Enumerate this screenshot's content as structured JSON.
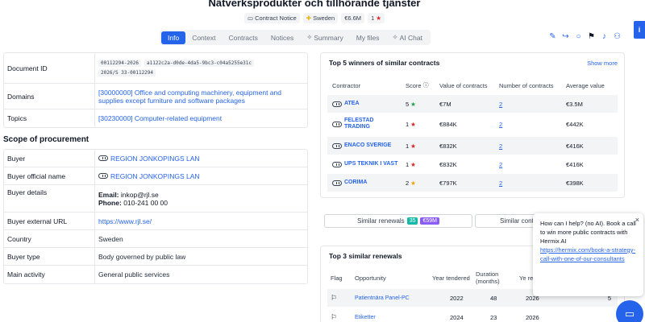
{
  "header": {
    "title": "Nätverksprodukter och tillhörande tjänster",
    "tags": {
      "notice": "Contract Notice",
      "country": "Sweden",
      "value": "€6.6M",
      "score": "1"
    }
  },
  "tabs": [
    {
      "label": "Info",
      "active": true
    },
    {
      "label": "Context"
    },
    {
      "label": "Contracts"
    },
    {
      "label": "Notices"
    },
    {
      "label": "Summary"
    },
    {
      "label": "My files"
    },
    {
      "label": "AI Chat"
    }
  ],
  "side_tab": {
    "label": "i"
  },
  "info": {
    "document_id": {
      "label": "Document ID",
      "ids": [
        "00112294-2026",
        "a1122c2a-d0de-4da5-9bc3-c04a5255e31c",
        "2026/S 33-00112294"
      ]
    },
    "domains": {
      "label": "Domains",
      "value": "[30000000] Office and computing machinery, equipment and supplies except furniture and software packages"
    },
    "topics": {
      "label": "Topics",
      "value": "[30230000] Computer-related equipment"
    }
  },
  "procurement": {
    "title": "Scope of procurement",
    "rows": {
      "buyer": {
        "label": "Buyer",
        "value": "REGION JONKOPINGS LAN"
      },
      "buyer_official": {
        "label": "Buyer official name",
        "value": "REGION JONKOPINGS LAN"
      },
      "buyer_details": {
        "label": "Buyer details",
        "email_label": "Email:",
        "email": "inkop@rjl.se",
        "phone_label": "Phone:",
        "phone": "010-241 00 00"
      },
      "buyer_url": {
        "label": "Buyer external URL",
        "value": "https://www.rjl.se/"
      },
      "country": {
        "label": "Country",
        "value": "Sweden"
      },
      "buyer_type": {
        "label": "Buyer type",
        "value": "Body governed by public law"
      },
      "main_activity": {
        "label": "Main activity",
        "value": "General public services"
      }
    }
  },
  "winners": {
    "title": "Top 5 winners of similar contracts",
    "show_more": "Show more",
    "headers": {
      "contractor": "Contractor",
      "score": "Score",
      "value": "Value of contracts",
      "number": "Number of contracts",
      "average": "Average value"
    },
    "rows": [
      {
        "name": "ATEA",
        "score": "5",
        "value": "€7M",
        "number": "2",
        "average": "€3.5M"
      },
      {
        "name": "FELESTAD TRADING",
        "score": "1",
        "value": "€884K",
        "number": "2",
        "average": "€442K"
      },
      {
        "name": "ENACO SVERIGE",
        "score": "1",
        "value": "€832K",
        "number": "2",
        "average": "€416K"
      },
      {
        "name": "UPS TEKNIK I VAST",
        "score": "1",
        "value": "€832K",
        "number": "2",
        "average": "€416K"
      },
      {
        "name": "CORIMA",
        "score": "2",
        "value": "€797K",
        "number": "2",
        "average": "€398K"
      }
    ]
  },
  "similar": {
    "renewals_label": "Similar renewals",
    "renewals_count": "35",
    "renewals_value": "€59M",
    "contracts_label": "Similar contr"
  },
  "renewals": {
    "title": "Top 3 similar renewals",
    "headers": {
      "flag": "Flag",
      "opportunity": "Opportunity",
      "year": "Year tendered",
      "duration": "Duration (months)",
      "renewal": "Ye re"
    },
    "rows": [
      {
        "opportunity": "Patientnära Panel-PC",
        "year": "2022",
        "duration": "48",
        "renewal": "2026",
        "extra": "5"
      },
      {
        "opportunity": "Etiketter",
        "year": "2024",
        "duration": "23",
        "renewal": "2026",
        "extra": ""
      }
    ]
  },
  "chat": {
    "message": "How can I help? (no AI). Book a call to win more public contracts with Hermix AI",
    "link": "https://hermix.com/book-a-strategy-call-with-one-of-our-consultants",
    "close": "×"
  }
}
